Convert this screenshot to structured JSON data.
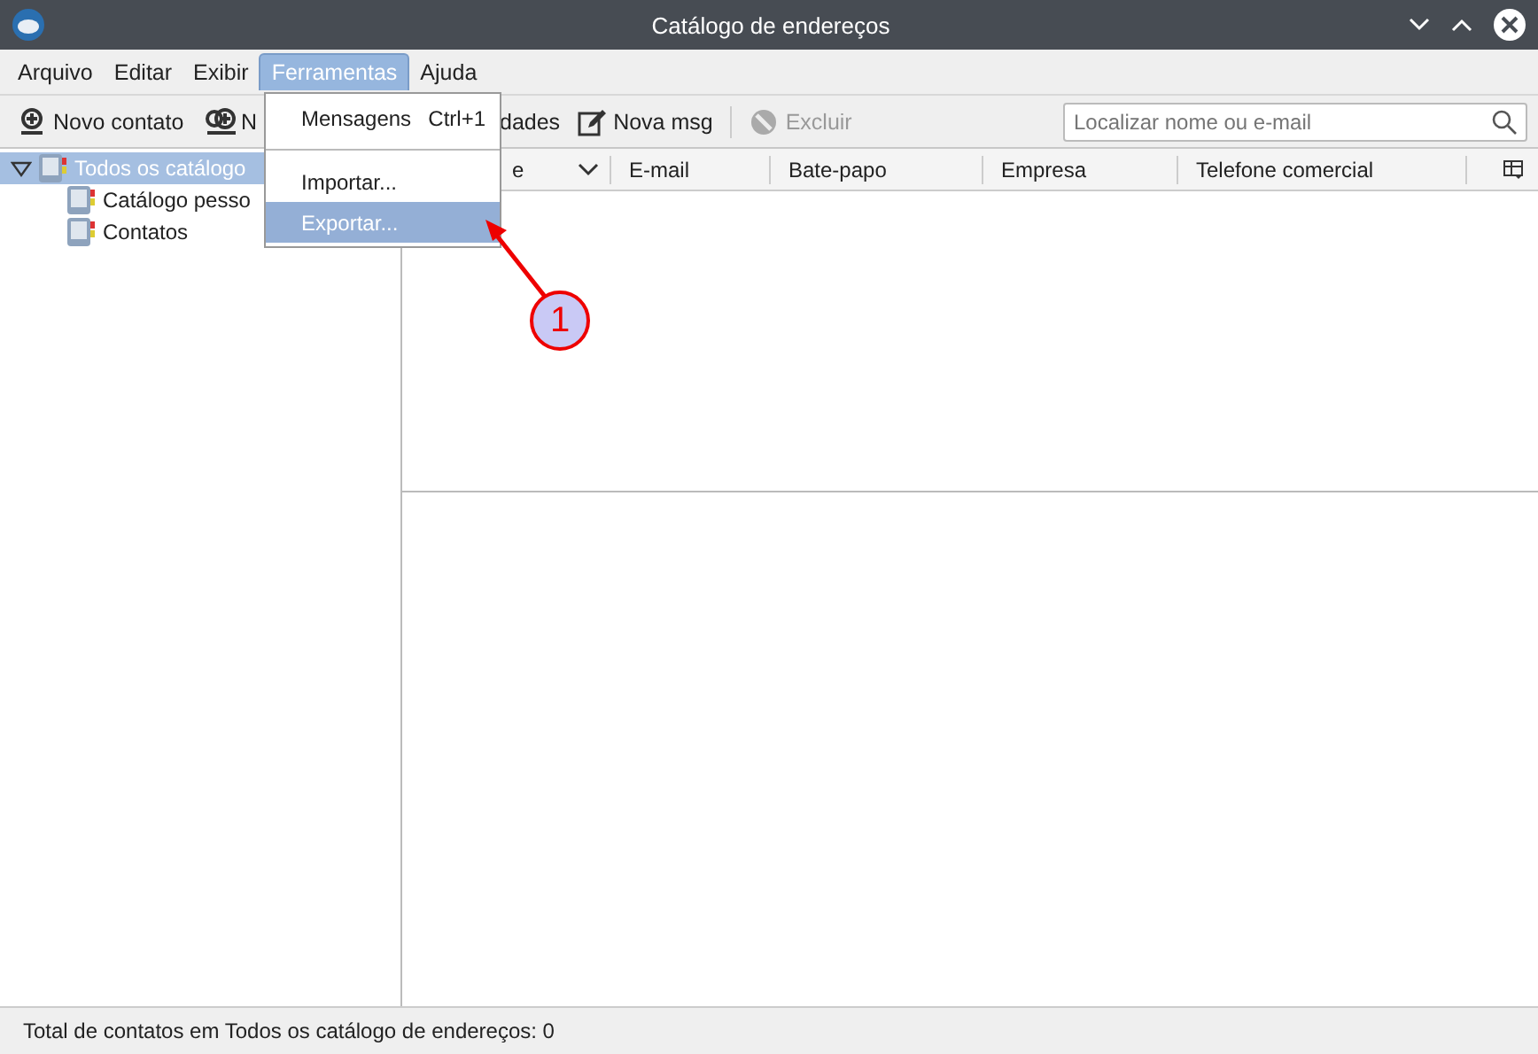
{
  "window": {
    "title": "Catálogo de endereços"
  },
  "menubar": [
    {
      "label": "Arquivo",
      "selected": false
    },
    {
      "label": "Editar",
      "selected": false
    },
    {
      "label": "Exibir",
      "selected": false
    },
    {
      "label": "Ferramentas",
      "selected": true
    },
    {
      "label": "Ajuda",
      "selected": false
    }
  ],
  "menu": {
    "items": [
      {
        "kind": "item",
        "label": "Mensagens",
        "shortcut": "Ctrl+1",
        "selected": false
      },
      {
        "kind": "separator"
      },
      {
        "kind": "item",
        "label": "Importar...",
        "selected": false
      },
      {
        "kind": "item",
        "label": "Exportar...",
        "selected": true
      }
    ]
  },
  "toolbar": [
    {
      "label": "Novo contato",
      "kind": "contact",
      "disabled": false
    },
    {
      "label": "N",
      "kind": "list",
      "disabled": false
    },
    {
      "label": "dades",
      "kind": "plain",
      "disabled": false
    },
    {
      "label": "Nova msg",
      "kind": "compose",
      "disabled": false
    },
    {
      "label": "Excluir",
      "kind": "delete",
      "disabled": true
    }
  ],
  "search": {
    "placeholder": "Localizar nome ou e-mail"
  },
  "tree": [
    {
      "label": "Todos os catálogo",
      "selected": true,
      "expanded": true,
      "children": [
        {
          "label": "Catálogo pesso",
          "selected": false
        },
        {
          "label": "Contatos",
          "selected": false
        }
      ]
    }
  ],
  "table": {
    "columns": [
      {
        "label": "e",
        "sorted": true
      },
      {
        "label": "E-mail",
        "sorted": false
      },
      {
        "label": "Bate-papo",
        "sorted": false
      },
      {
        "label": "Empresa",
        "sorted": false
      },
      {
        "label": "Telefone comercial",
        "sorted": false
      }
    ]
  },
  "callout": {
    "label": "1"
  },
  "status_bar": "Total de contatos em Todos os catálogo de endereços: 0"
}
